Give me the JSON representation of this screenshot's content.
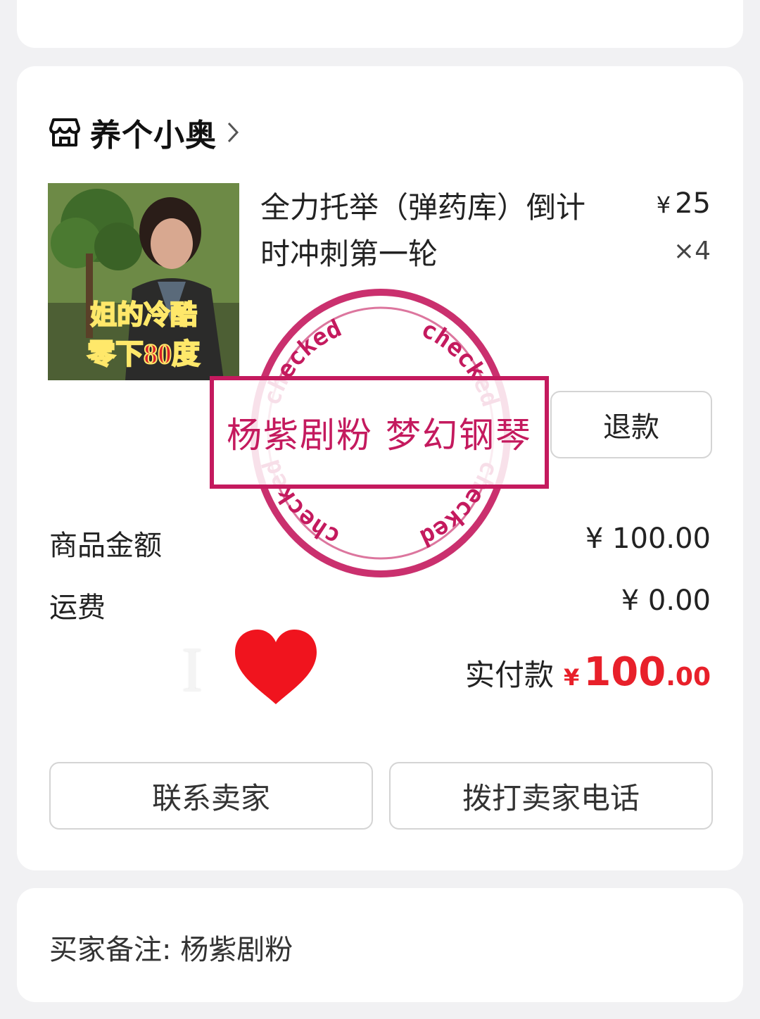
{
  "shop": {
    "name": "养个小奥"
  },
  "product": {
    "title": "全力托举（弹药库）倒计时冲刺第一轮",
    "price_symbol": "¥",
    "price": "25",
    "quantity": "×4",
    "image_caption_line1": "姐的冷酷",
    "image_caption_line2": "零下80度",
    "refund_label": "退款"
  },
  "summary": {
    "goods_label": "商品金额",
    "goods_value": "¥ 100.00",
    "shipping_label": "运费",
    "shipping_value": "¥ 0.00",
    "paid_label": "实付款",
    "paid_symbol": "¥",
    "paid_int": "100",
    "paid_dec": ".00"
  },
  "overlay": {
    "love_text": "I",
    "stamp_text": "杨紫剧粉 梦幻钢琴",
    "stamp_word": "checked"
  },
  "actions": {
    "contact_label": "联系卖家",
    "call_label": "拨打卖家电话"
  },
  "note": {
    "text": "买家备注: 杨紫剧粉"
  },
  "colors": {
    "accent": "#e8202a",
    "stamp": "#c41a5e",
    "background": "#f1f1f3"
  }
}
